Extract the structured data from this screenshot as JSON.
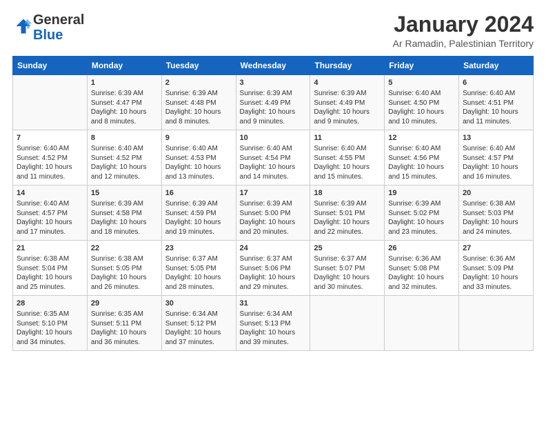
{
  "logo": {
    "general": "General",
    "blue": "Blue"
  },
  "title": "January 2024",
  "subtitle": "Ar Ramadin, Palestinian Territory",
  "headers": [
    "Sunday",
    "Monday",
    "Tuesday",
    "Wednesday",
    "Thursday",
    "Friday",
    "Saturday"
  ],
  "weeks": [
    [
      {
        "day": "",
        "lines": []
      },
      {
        "day": "1",
        "lines": [
          "Sunrise: 6:39 AM",
          "Sunset: 4:47 PM",
          "Daylight: 10 hours",
          "and 8 minutes."
        ]
      },
      {
        "day": "2",
        "lines": [
          "Sunrise: 6:39 AM",
          "Sunset: 4:48 PM",
          "Daylight: 10 hours",
          "and 8 minutes."
        ]
      },
      {
        "day": "3",
        "lines": [
          "Sunrise: 6:39 AM",
          "Sunset: 4:49 PM",
          "Daylight: 10 hours",
          "and 9 minutes."
        ]
      },
      {
        "day": "4",
        "lines": [
          "Sunrise: 6:39 AM",
          "Sunset: 4:49 PM",
          "Daylight: 10 hours",
          "and 9 minutes."
        ]
      },
      {
        "day": "5",
        "lines": [
          "Sunrise: 6:40 AM",
          "Sunset: 4:50 PM",
          "Daylight: 10 hours",
          "and 10 minutes."
        ]
      },
      {
        "day": "6",
        "lines": [
          "Sunrise: 6:40 AM",
          "Sunset: 4:51 PM",
          "Daylight: 10 hours",
          "and 11 minutes."
        ]
      }
    ],
    [
      {
        "day": "7",
        "lines": [
          "Sunrise: 6:40 AM",
          "Sunset: 4:52 PM",
          "Daylight: 10 hours",
          "and 11 minutes."
        ]
      },
      {
        "day": "8",
        "lines": [
          "Sunrise: 6:40 AM",
          "Sunset: 4:52 PM",
          "Daylight: 10 hours",
          "and 12 minutes."
        ]
      },
      {
        "day": "9",
        "lines": [
          "Sunrise: 6:40 AM",
          "Sunset: 4:53 PM",
          "Daylight: 10 hours",
          "and 13 minutes."
        ]
      },
      {
        "day": "10",
        "lines": [
          "Sunrise: 6:40 AM",
          "Sunset: 4:54 PM",
          "Daylight: 10 hours",
          "and 14 minutes."
        ]
      },
      {
        "day": "11",
        "lines": [
          "Sunrise: 6:40 AM",
          "Sunset: 4:55 PM",
          "Daylight: 10 hours",
          "and 15 minutes."
        ]
      },
      {
        "day": "12",
        "lines": [
          "Sunrise: 6:40 AM",
          "Sunset: 4:56 PM",
          "Daylight: 10 hours",
          "and 15 minutes."
        ]
      },
      {
        "day": "13",
        "lines": [
          "Sunrise: 6:40 AM",
          "Sunset: 4:57 PM",
          "Daylight: 10 hours",
          "and 16 minutes."
        ]
      }
    ],
    [
      {
        "day": "14",
        "lines": [
          "Sunrise: 6:40 AM",
          "Sunset: 4:57 PM",
          "Daylight: 10 hours",
          "and 17 minutes."
        ]
      },
      {
        "day": "15",
        "lines": [
          "Sunrise: 6:39 AM",
          "Sunset: 4:58 PM",
          "Daylight: 10 hours",
          "and 18 minutes."
        ]
      },
      {
        "day": "16",
        "lines": [
          "Sunrise: 6:39 AM",
          "Sunset: 4:59 PM",
          "Daylight: 10 hours",
          "and 19 minutes."
        ]
      },
      {
        "day": "17",
        "lines": [
          "Sunrise: 6:39 AM",
          "Sunset: 5:00 PM",
          "Daylight: 10 hours",
          "and 20 minutes."
        ]
      },
      {
        "day": "18",
        "lines": [
          "Sunrise: 6:39 AM",
          "Sunset: 5:01 PM",
          "Daylight: 10 hours",
          "and 22 minutes."
        ]
      },
      {
        "day": "19",
        "lines": [
          "Sunrise: 6:39 AM",
          "Sunset: 5:02 PM",
          "Daylight: 10 hours",
          "and 23 minutes."
        ]
      },
      {
        "day": "20",
        "lines": [
          "Sunrise: 6:38 AM",
          "Sunset: 5:03 PM",
          "Daylight: 10 hours",
          "and 24 minutes."
        ]
      }
    ],
    [
      {
        "day": "21",
        "lines": [
          "Sunrise: 6:38 AM",
          "Sunset: 5:04 PM",
          "Daylight: 10 hours",
          "and 25 minutes."
        ]
      },
      {
        "day": "22",
        "lines": [
          "Sunrise: 6:38 AM",
          "Sunset: 5:05 PM",
          "Daylight: 10 hours",
          "and 26 minutes."
        ]
      },
      {
        "day": "23",
        "lines": [
          "Sunrise: 6:37 AM",
          "Sunset: 5:05 PM",
          "Daylight: 10 hours",
          "and 28 minutes."
        ]
      },
      {
        "day": "24",
        "lines": [
          "Sunrise: 6:37 AM",
          "Sunset: 5:06 PM",
          "Daylight: 10 hours",
          "and 29 minutes."
        ]
      },
      {
        "day": "25",
        "lines": [
          "Sunrise: 6:37 AM",
          "Sunset: 5:07 PM",
          "Daylight: 10 hours",
          "and 30 minutes."
        ]
      },
      {
        "day": "26",
        "lines": [
          "Sunrise: 6:36 AM",
          "Sunset: 5:08 PM",
          "Daylight: 10 hours",
          "and 32 minutes."
        ]
      },
      {
        "day": "27",
        "lines": [
          "Sunrise: 6:36 AM",
          "Sunset: 5:09 PM",
          "Daylight: 10 hours",
          "and 33 minutes."
        ]
      }
    ],
    [
      {
        "day": "28",
        "lines": [
          "Sunrise: 6:35 AM",
          "Sunset: 5:10 PM",
          "Daylight: 10 hours",
          "and 34 minutes."
        ]
      },
      {
        "day": "29",
        "lines": [
          "Sunrise: 6:35 AM",
          "Sunset: 5:11 PM",
          "Daylight: 10 hours",
          "and 36 minutes."
        ]
      },
      {
        "day": "30",
        "lines": [
          "Sunrise: 6:34 AM",
          "Sunset: 5:12 PM",
          "Daylight: 10 hours",
          "and 37 minutes."
        ]
      },
      {
        "day": "31",
        "lines": [
          "Sunrise: 6:34 AM",
          "Sunset: 5:13 PM",
          "Daylight: 10 hours",
          "and 39 minutes."
        ]
      },
      {
        "day": "",
        "lines": []
      },
      {
        "day": "",
        "lines": []
      },
      {
        "day": "",
        "lines": []
      }
    ]
  ]
}
